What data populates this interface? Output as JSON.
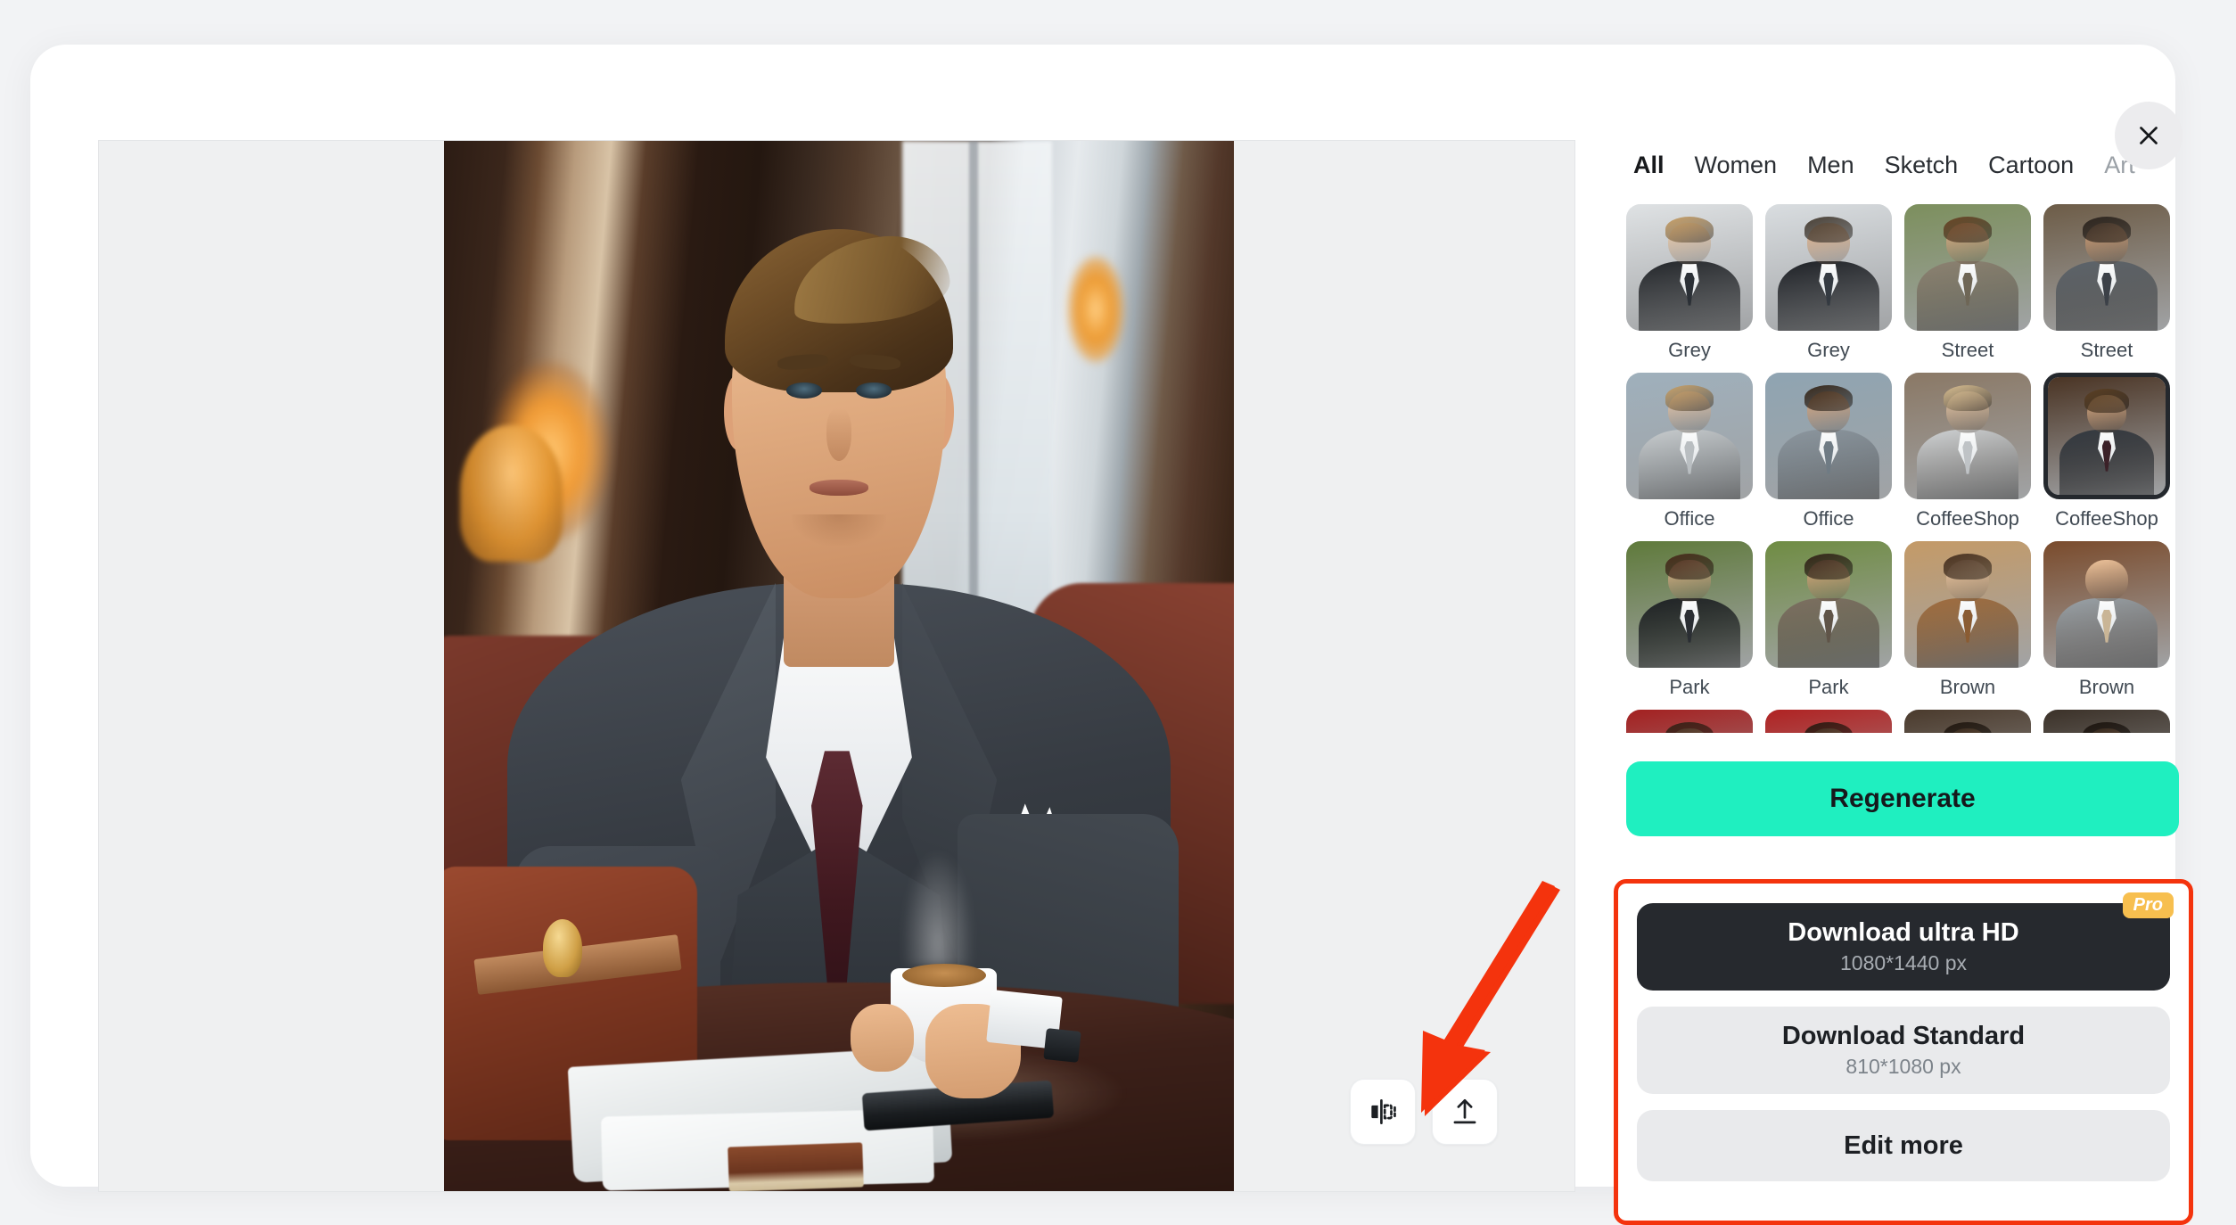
{
  "modal": {
    "close_label": "Close",
    "close_icon": "close-icon"
  },
  "canvas": {
    "tools": [
      {
        "name": "mirror-flip-icon",
        "label": "Mirror"
      },
      {
        "name": "upload-share-icon",
        "label": "Upload"
      }
    ]
  },
  "sidebar": {
    "tabs": [
      {
        "label": "All",
        "state": "active"
      },
      {
        "label": "Women",
        "state": "default"
      },
      {
        "label": "Men",
        "state": "default"
      },
      {
        "label": "Sketch",
        "state": "default"
      },
      {
        "label": "Cartoon",
        "state": "default"
      },
      {
        "label": "Art",
        "state": "muted"
      }
    ],
    "styles": [
      {
        "label": "Grey",
        "selected": false,
        "bg": "#dfe2e4",
        "hair": "#c9a066",
        "face": "#f0cba6",
        "body": "#23262a",
        "tie": "#2b3036"
      },
      {
        "label": "Grey",
        "selected": false,
        "bg": "#d9dde0",
        "hair": "#4a4035",
        "face": "#e6b489",
        "body": "#1e2126",
        "tie": "#343a41"
      },
      {
        "label": "Street",
        "selected": false,
        "bg": "#7c8f5d",
        "hair": "#6b4526",
        "face": "#e7b38a",
        "body": "#8d8272",
        "tie": "#6e6656"
      },
      {
        "label": "Street",
        "selected": false,
        "bg": "#6d5c47",
        "hair": "#2e2620",
        "face": "#dca87e",
        "body": "#5d646b",
        "tie": "#3c4148"
      },
      {
        "label": "Office",
        "selected": false,
        "bg": "#9fb0bc",
        "hair": "#c9a26a",
        "face": "#f1cba9",
        "body": "#c8ccce",
        "tie": "#b9bec1"
      },
      {
        "label": "Office",
        "selected": false,
        "bg": "#8fa4b2",
        "hair": "#3a2a1c",
        "face": "#e3ac80",
        "body": "#8c969e",
        "tie": "#6f7b84"
      },
      {
        "label": "CoffeeShop",
        "selected": false,
        "bg": "#8a7865",
        "hair": "#d9bf92",
        "face": "#f2d0ad",
        "body": "#cfd2d4",
        "tie": "#bfc3c6"
      },
      {
        "label": "CoffeeShop",
        "selected": true,
        "bg": "#4a3424",
        "hair": "#5c4124",
        "face": "#e8b78c",
        "body": "#343a41",
        "tie": "#3b2128"
      },
      {
        "label": "Park",
        "selected": false,
        "bg": "#5f7a3b",
        "hair": "#4a2c1c",
        "face": "#e8b990",
        "body": "#1f2226",
        "tie": "#2a2e33"
      },
      {
        "label": "Park",
        "selected": false,
        "bg": "#6f8c43",
        "hair": "#35251a",
        "face": "#e5ae83",
        "body": "#7d6f61",
        "tie": "#5f5448"
      },
      {
        "label": "Brown",
        "selected": false,
        "bg": "#c49a67",
        "hair": "#4b3322",
        "face": "#f0cba7",
        "body": "#a06d3f",
        "tie": "#8a5c33"
      },
      {
        "label": "Brown",
        "selected": false,
        "bg": "#7a4b2c",
        "hair": "#b5handled",
        "face": "#efc49c",
        "body": "#9aa3a9",
        "tie": "#c9b596"
      },
      {
        "label": "",
        "selected": false,
        "bg": "#a32020",
        "hair": "#3a2418",
        "face": "#e5b68c",
        "body": "#8d1c1c",
        "tie": "#6d1515"
      },
      {
        "label": "",
        "selected": false,
        "bg": "#b02222",
        "hair": "#2e1d13",
        "face": "#e2b288",
        "body": "#911d1d",
        "tie": "#701616"
      },
      {
        "label": "",
        "selected": false,
        "bg": "#4a3a2c",
        "hair": "#241a12",
        "face": "#d8a87e",
        "body": "#2b2620",
        "tie": "#1d1915"
      },
      {
        "label": "",
        "selected": false,
        "bg": "#3b3128",
        "hair": "#1f1711",
        "face": "#d5a47b",
        "body": "#26211b",
        "tie": "#191510"
      }
    ]
  },
  "actions": {
    "regenerate_label": "Regenerate",
    "download_hd": {
      "title": "Download ultra HD",
      "subtitle": "1080*1440 px",
      "badge": "Pro"
    },
    "download_standard": {
      "title": "Download Standard",
      "subtitle": "810*1080 px"
    },
    "edit_more": {
      "title": "Edit more"
    }
  },
  "colors": {
    "accent_teal": "#1fefc0",
    "highlight_red": "#f4330d",
    "pro_badge": "#f7bf4f",
    "dark_button": "#26292e"
  }
}
